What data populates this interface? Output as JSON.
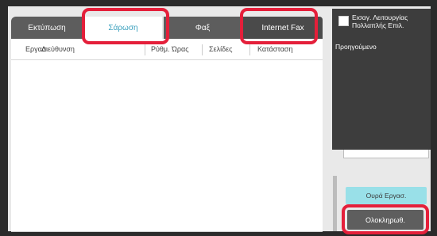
{
  "tabs": [
    {
      "label": "Εκτύπωση"
    },
    {
      "label": "Σάρωση"
    },
    {
      "label": "Φαξ"
    },
    {
      "label": "Internet Fax"
    }
  ],
  "list": {
    "columns": [
      "Εργασ",
      "Διεύθυνση",
      "Ρύθμ. Ώρας",
      "Σελίδες",
      "Κατάσταση"
    ]
  },
  "side": {
    "checkbox_label": "Εισαγ. Λειτουργίας Πολλαπλής Επιλ.",
    "previous": "Προηγούμενο"
  },
  "buttons": {
    "queue": "Ουρά Εργασ.",
    "done": "Ολοκληρωθ."
  },
  "colors": {
    "highlight": "#e41f3a",
    "active_tab_text": "#3aa0bd",
    "queue_button": "#99e0e8"
  }
}
